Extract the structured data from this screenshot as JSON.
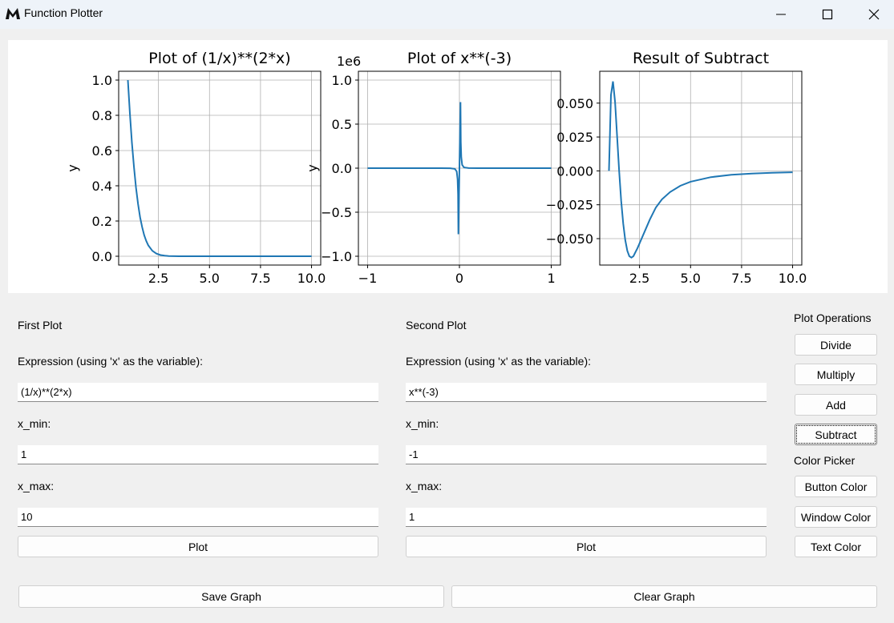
{
  "window": {
    "title": "Function Plotter",
    "logo_letter": "M"
  },
  "first_plot": {
    "section_label": "First Plot",
    "expression_label": "Expression (using 'x' as the variable):",
    "expression_value": "(1/x)**(2*x)",
    "xmin_label": "x_min:",
    "xmin_value": "1",
    "xmax_label": "x_max:",
    "xmax_value": "10",
    "plot_button": "Plot"
  },
  "second_plot": {
    "section_label": "Second Plot",
    "expression_label": "Expression (using 'x' as the variable):",
    "expression_value": "x**(-3)",
    "xmin_label": "x_min:",
    "xmin_value": "-1",
    "xmax_label": "x_max:",
    "xmax_value": "1",
    "plot_button": "Plot"
  },
  "operations": {
    "title": "Plot Operations",
    "buttons": [
      "Divide",
      "Multiply",
      "Add",
      "Subtract"
    ]
  },
  "color_picker": {
    "title": "Color Picker",
    "buttons": [
      "Button Color",
      "Window Color",
      "Text Color"
    ]
  },
  "bottom": {
    "save": "Save Graph",
    "clear": "Clear Graph"
  },
  "line_color": "#1f77b4",
  "chart_data": [
    {
      "type": "line",
      "title": "Plot of (1/x)**(2*x)",
      "xlabel": "",
      "ylabel": "y",
      "xlim": [
        0.55,
        10.45
      ],
      "ylim": [
        -0.05,
        1.05
      ],
      "xticks": [
        2.5,
        5.0,
        7.5,
        10.0
      ],
      "xtick_labels": [
        "2.5",
        "5.0",
        "7.5",
        "10.0"
      ],
      "yticks": [
        0.0,
        0.2,
        0.4,
        0.6,
        0.8,
        1.0
      ],
      "ytick_labels": [
        "0.0",
        "0.2",
        "0.4",
        "0.6",
        "0.8",
        "1.0"
      ],
      "grid": true,
      "x": [
        1.0,
        1.1,
        1.2,
        1.3,
        1.4,
        1.5,
        1.6,
        1.7,
        1.8,
        1.9,
        2.0,
        2.2,
        2.4,
        2.6,
        2.8,
        3.0,
        3.5,
        4.0,
        5.0,
        6.0,
        7.0,
        8.0,
        9.0,
        10.0
      ],
      "y": [
        1.0,
        0.811,
        0.645,
        0.506,
        0.39,
        0.296,
        0.222,
        0.165,
        0.12,
        0.087,
        0.0625,
        0.031,
        0.015,
        0.007,
        0.003,
        0.0014,
        0.0002,
        0.0,
        0.0,
        0.0,
        0.0,
        0.0,
        0.0,
        0.0
      ]
    },
    {
      "type": "line",
      "title": "Plot of x**(-3)",
      "offset_label": "1e6",
      "xlabel": "",
      "ylabel": "y",
      "xlim": [
        -1.1,
        1.1
      ],
      "ylim": [
        -1.1,
        1.1
      ],
      "xticks": [
        -1,
        0,
        1
      ],
      "xtick_labels": [
        "−1",
        "0",
        "1"
      ],
      "yticks": [
        -1.0,
        -0.5,
        0.0,
        0.5,
        1.0
      ],
      "ytick_labels": [
        "−1.0",
        "−0.5",
        "0.0",
        "0.5",
        "1.0"
      ],
      "grid": true,
      "x": [
        -1.0,
        -0.5,
        -0.2,
        -0.1,
        -0.05,
        -0.03,
        -0.02,
        -0.015,
        -0.011,
        0.011,
        0.015,
        0.02,
        0.03,
        0.05,
        0.1,
        0.2,
        0.5,
        1.0
      ],
      "y": [
        -1e-06,
        -8e-06,
        -0.000125,
        -0.001,
        -0.008,
        -0.037,
        -0.125,
        -0.296,
        -0.75,
        0.75,
        0.296,
        0.125,
        0.037,
        0.008,
        0.001,
        0.000125,
        8e-06,
        1e-06
      ]
    },
    {
      "type": "line",
      "title": "Result of Subtract",
      "xlabel": "",
      "ylabel": "",
      "xlim": [
        0.55,
        10.45
      ],
      "ylim": [
        -0.0695,
        0.0735
      ],
      "xticks": [
        2.5,
        5.0,
        7.5,
        10.0
      ],
      "xtick_labels": [
        "2.5",
        "5.0",
        "7.5",
        "10.0"
      ],
      "yticks": [
        -0.05,
        -0.025,
        0.0,
        0.025,
        0.05
      ],
      "ytick_labels": [
        "−0.050",
        "−0.025",
        "0.000",
        "0.025",
        "0.050"
      ],
      "grid": true,
      "x": [
        1.0,
        1.1,
        1.2,
        1.3,
        1.4,
        1.5,
        1.6,
        1.7,
        1.8,
        1.9,
        2.0,
        2.1,
        2.2,
        2.3,
        2.4,
        2.6,
        2.8,
        3.0,
        3.3,
        3.6,
        4.0,
        4.5,
        5.0,
        6.0,
        7.0,
        8.0,
        9.0,
        10.0
      ],
      "y": [
        0.0,
        0.056,
        0.066,
        0.051,
        0.026,
        0.0,
        -0.022,
        -0.039,
        -0.051,
        -0.059,
        -0.063,
        -0.064,
        -0.063,
        -0.06,
        -0.057,
        -0.05,
        -0.043,
        -0.036,
        -0.027,
        -0.021,
        -0.0156,
        -0.011,
        -0.008,
        -0.0046,
        -0.0029,
        -0.002,
        -0.0014,
        -0.001
      ]
    }
  ]
}
